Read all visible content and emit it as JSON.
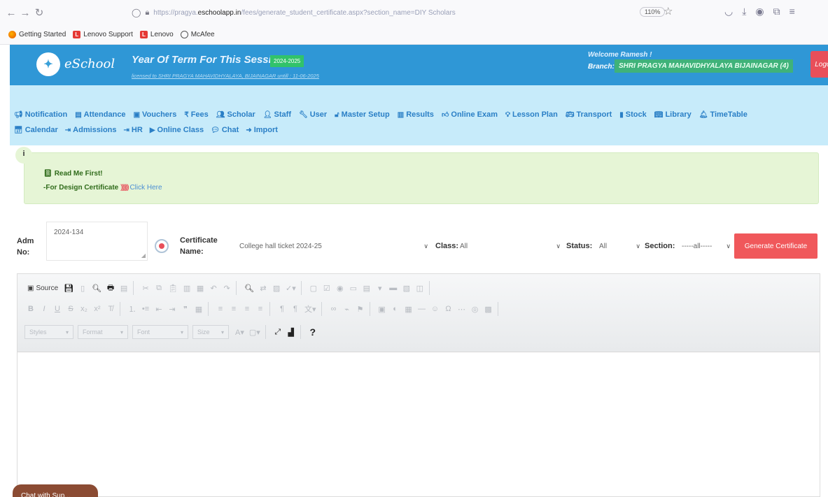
{
  "browser": {
    "url_prefix": "https://pragya.",
    "url_host": "eschoolapp.in",
    "url_path": "/fees/generate_student_certificate.aspx?section_name=DIY Scholars",
    "zoom": "110%",
    "bookmarks": [
      "Getting Started",
      "Lenovo Support",
      "Lenovo",
      "McAfee"
    ]
  },
  "header": {
    "logo_text": "eSchool",
    "term_label": "Year Of Term For This Session :-",
    "term_value": "2024-2025",
    "license_text": "licensed to SHRI PRAGYA MAHAVIDHYALAYA, BIJAINAGAR untill : 11-06-2025",
    "welcome": "Welcome Ramesh !",
    "branch_label": "Branch:",
    "branch_value": "SHRI PRAGYA MAHAVIDHYALAYA BIJAINAGAR (4)",
    "logout": "Logout"
  },
  "menu": {
    "row1": [
      "Notification",
      "Attendance",
      "Vouchers",
      "Fees",
      "Scholar",
      "Staff",
      "User",
      "Master Setup",
      "Results",
      "Online Exam",
      "Lesson Plan",
      "Transport",
      "Stock",
      "Library",
      "TimeTable"
    ],
    "row2": [
      "Calendar",
      "Admissions",
      "HR",
      "Online Class",
      "Chat",
      "Import"
    ]
  },
  "info": {
    "icon": "i",
    "readme": "Read Me First!",
    "design_prefix": "-For Design Certificate",
    "arrows": "))))))))",
    "click_here": "Click Here"
  },
  "form": {
    "adm_label_1": "Adm",
    "adm_label_2": "No:",
    "adm_value": "2024-134",
    "cert_label_1": "Certificate",
    "cert_label_2": "Name:",
    "cert_value": "College hall ticket 2024-25",
    "class_label": "Class:",
    "class_value": "All",
    "status_label": "Status:",
    "status_value": "All",
    "section_label": "Section:",
    "section_value": "-----all-----",
    "generate_button": "Generate Certificate"
  },
  "editor": {
    "source_label": "Source",
    "combo_styles": "Styles",
    "combo_format": "Format",
    "combo_font": "Font",
    "combo_size": "Size"
  },
  "chat": {
    "label": "Chat with Sup..."
  },
  "colors": {
    "header_blue": "#2f97d6",
    "menu_bg": "#c7ebfa",
    "accent_red": "#f0585b",
    "term_green": "#31c36a"
  }
}
